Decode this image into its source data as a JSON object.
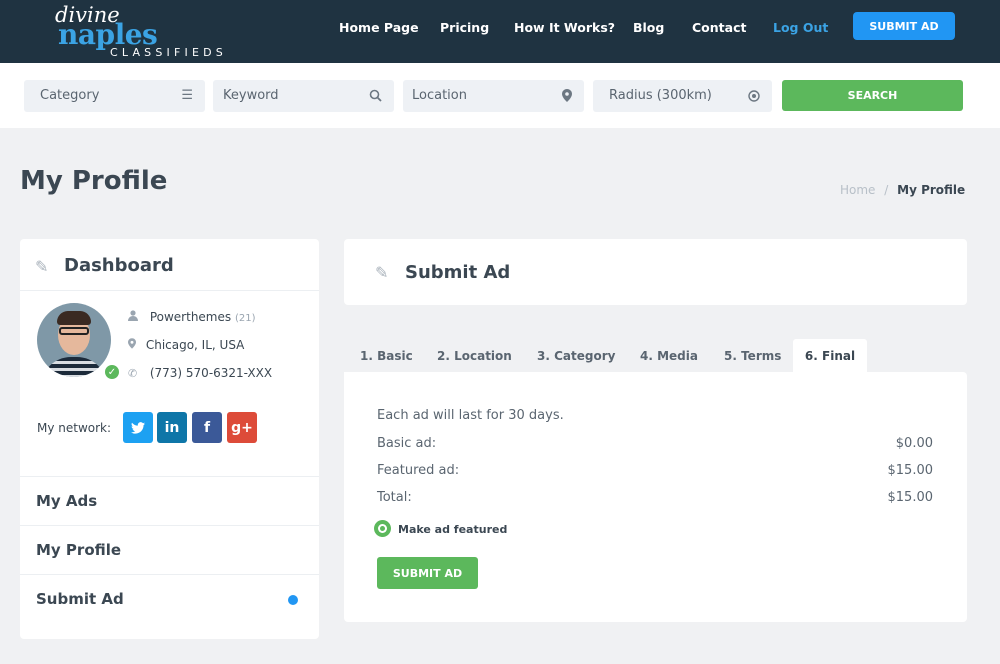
{
  "logo": {
    "line1": "divine",
    "line2": "naples",
    "line3": "CLASSIFIEDS"
  },
  "nav": {
    "home": "Home Page",
    "pricing": "Pricing",
    "how": "How It Works?",
    "blog": "Blog",
    "contact": "Contact",
    "logout": "Log Out",
    "submit": "SUBMIT AD"
  },
  "search": {
    "category": "Category",
    "keyword": "Keyword",
    "location": "Location",
    "radius": "Radius (300km)",
    "button": "SEARCH"
  },
  "page": {
    "title": "My Profile"
  },
  "breadcrumb": {
    "home": "Home",
    "sep": "/",
    "current": "My Profile"
  },
  "sidebar": {
    "title": "Dashboard",
    "user": {
      "name": "Powerthemes",
      "count": "(21)",
      "location": "Chicago, IL, USA",
      "phone": "(773) 570-6321-XXX"
    },
    "network_label": "My network:",
    "social": {
      "twitter": "t",
      "linkedin": "in",
      "facebook": "f",
      "google": "g+"
    },
    "menu": [
      "My Ads",
      "My Profile",
      "Submit Ad"
    ]
  },
  "submit": {
    "title": "Submit Ad",
    "tabs": [
      "1. Basic",
      "2. Location",
      "3. Category",
      "4. Media",
      "5. Terms",
      "6. Final"
    ],
    "active_tab": "6. Final",
    "intro": "Each ad will last for 30 days.",
    "rows": [
      {
        "label": "Basic ad:",
        "value": "$0.00"
      },
      {
        "label": "Featured ad:",
        "value": "$15.00"
      },
      {
        "label": "Total:",
        "value": "$15.00"
      }
    ],
    "featured_label": "Make ad featured",
    "button": "SUBMIT AD"
  },
  "icons": {
    "menu": "menu-icon",
    "search": "search-icon",
    "pin": "map-pin-icon",
    "target": "target-icon",
    "pencil": "pencil-icon",
    "user": "user-icon",
    "phone": "phone-icon"
  },
  "colors": {
    "header": "#1f3341",
    "accent_blue": "#2196f3",
    "green": "#5cb85c",
    "logo_blue": "#3ba3e4"
  }
}
